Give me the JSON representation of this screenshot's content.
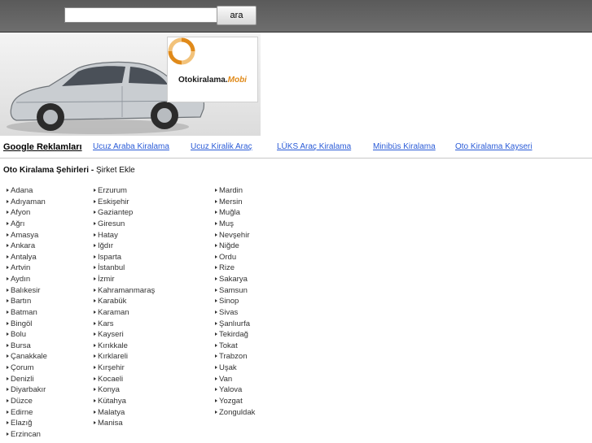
{
  "search": {
    "value": "",
    "placeholder": "",
    "button_label": "ara"
  },
  "banner": {
    "logo_text_main": "Otokiralama.",
    "logo_text_accent": "Mobi"
  },
  "ads": {
    "title": "Google Reklamları",
    "links": [
      "Ucuz Araba Kiralama",
      "Ucuz Kiralik Araç",
      "LÜKS Araç Kiralama",
      "Minibüs Kiralama",
      "Oto Kiralama Kayseri"
    ]
  },
  "section": {
    "title": "Oto Kiralama Şehirleri",
    "separator": " - ",
    "add_company": "Şirket Ekle"
  },
  "cities": {
    "col1": [
      "Adana",
      "Adıyaman",
      "Afyon",
      "Ağrı",
      "Amasya",
      "Ankara",
      "Antalya",
      "Artvin",
      "Aydın",
      "Balıkesir",
      "Bartın",
      "Batman",
      "Bingöl",
      "Bolu",
      "Bursa",
      "Çanakkale",
      "Çorum",
      "Denizli",
      "Diyarbakır",
      "Düzce",
      "Edirne",
      "Elazığ",
      "Erzincan"
    ],
    "col2": [
      "Erzurum",
      "Eskişehir",
      "Gaziantep",
      "Giresun",
      "Hatay",
      "Iğdır",
      "Isparta",
      "İstanbul",
      "İzmir",
      "Kahramanmaraş",
      "Karabük",
      "Karaman",
      "Kars",
      "Kayseri",
      "Kırıkkale",
      "Kırklareli",
      "Kırşehir",
      "Kocaeli",
      "Konya",
      "Kütahya",
      "Malatya",
      "Manisa"
    ],
    "col3": [
      "Mardin",
      "Mersin",
      "Muğla",
      "Muş",
      "Nevşehir",
      "Niğde",
      "Ordu",
      "Rize",
      "Sakarya",
      "Samsun",
      "Sinop",
      "Sivas",
      "Şanlıurfa",
      "Tekirdağ",
      "Tokat",
      "Trabzon",
      "Uşak",
      "Van",
      "Yalova",
      "Yozgat",
      "Zonguldak"
    ]
  },
  "colors": {
    "topbar": "#666666",
    "link": "#2a5bd7",
    "logo_accent": "#e08a1a"
  }
}
